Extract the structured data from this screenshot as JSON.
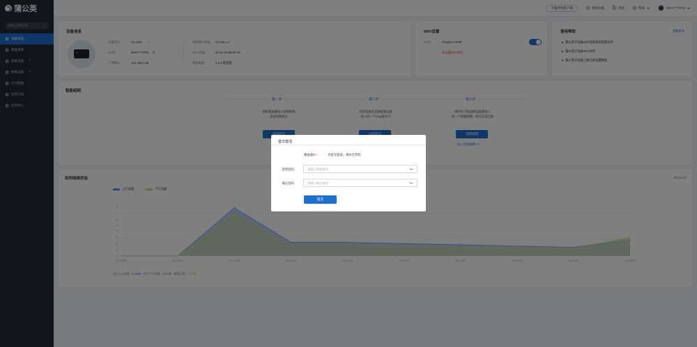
{
  "brand": {
    "name": "蒲公英"
  },
  "sidebar": {
    "search_placeholder": "请输入搜索内容",
    "items": [
      {
        "label": "设备状态",
        "active": true
      },
      {
        "label": "智能组网",
        "dot": false
      },
      {
        "label": "系统设置",
        "dot": true
      },
      {
        "label": "网络设置",
        "dot": true
      },
      {
        "label": "行为管理",
        "dot": false
      },
      {
        "label": "应用工具",
        "dot": false
      },
      {
        "label": "应用中心",
        "dot": false
      }
    ]
  },
  "topbar": {
    "download": "下载手机客户端",
    "system_upgrade": "系统升级",
    "notice": "消息",
    "help": "帮助",
    "account": "9604****9790"
  },
  "device": {
    "title": "设备信息",
    "model_label": "设备型号:",
    "model_value": "X1-2111",
    "sn_label": "SN码:",
    "sn_value": "9604****9790",
    "wan_label": "广域网IP:",
    "wan_value": "192.168.2.36",
    "lan_label": "局域网IP地址:",
    "lan_value": "10.168.1.1",
    "mac_label": "MAC地址:",
    "mac_value": "40:15:7D:69:3F:49",
    "fw_label": "系统版本:",
    "fw_value": "3.4.3 稳定版"
  },
  "wifi": {
    "title": "WiFi设置",
    "band": "2.4G:",
    "ssid": "OrayBox-XF69",
    "enabled": true,
    "warning": "未设置WiFi密码"
  },
  "help": {
    "title": "使用帮助",
    "more": "查看更多",
    "items": [
      "蒲公英子设备WiFi连接状态配置文件",
      "蒲公英子设备NAS文件",
      "蒲公英子设备上网方式设置教程"
    ]
  },
  "network": {
    "title": "智能组网",
    "steps": [
      {
        "label": "第一步",
        "desc1": "请将路由器加入组网网络",
        "desc2": "选择组网成员",
        "button": "添加成员",
        "link": ""
      },
      {
        "label": "第二步",
        "desc1": "您的设备已连接组网设备",
        "desc2": "进入同一个Oray账号下",
        "button": "分配成员",
        "link": ""
      },
      {
        "label": "第三步",
        "desc1": "将所有下级组网设备都接入",
        "desc2": "同一个智能网络，即可实现互联",
        "button": "创建组网",
        "link": "加入已有网络 >>"
      }
    ]
  },
  "status": {
    "title": "实时网络状态",
    "more": "单位KB/秒",
    "legend_up": "上行流量",
    "legend_down": "下行流量",
    "footer": [
      {
        "k": "总计上行流量",
        "v": "5.06MB"
      },
      {
        "k": "总计下行流量",
        "v": "1.87MB"
      },
      {
        "k": "峰值下载",
        "v": "7.62KB"
      }
    ]
  },
  "chart_data": {
    "type": "area",
    "x": [
      "16:13:05",
      "16:13:10",
      "16:13:15",
      "16:13:20",
      "16:13:25",
      "16:13:30",
      "16:13:35",
      "16:13:40",
      "16:13:45",
      "16:13:50"
    ],
    "y_ticks": [
      "0",
      "1",
      "2",
      "3",
      "4",
      "5",
      "6",
      "7",
      "8"
    ],
    "ylim": [
      0,
      8
    ],
    "series": [
      {
        "name": "上行流量",
        "color": "#5b8ff9",
        "values": [
          0,
          0,
          7.8,
          2.2,
          2.2,
          2.0,
          1.8,
          1.6,
          1.4,
          2.6
        ]
      },
      {
        "name": "下行流量",
        "color": "#cdd98b",
        "values": [
          0,
          0,
          7.0,
          1.9,
          1.9,
          1.7,
          1.5,
          1.4,
          1.2,
          3.0
        ]
      }
    ]
  },
  "dialog": {
    "title": "首次激活",
    "note_prefix": "路由器",
    "note_id": "96...",
    "note_suffix": "为首次登录，请补全资料",
    "password_label": "管理密码:",
    "password_placeholder": "请输入管理密码",
    "confirm_label": "确认密码:",
    "confirm_placeholder": "请输入确认密码",
    "submit": "提交"
  }
}
